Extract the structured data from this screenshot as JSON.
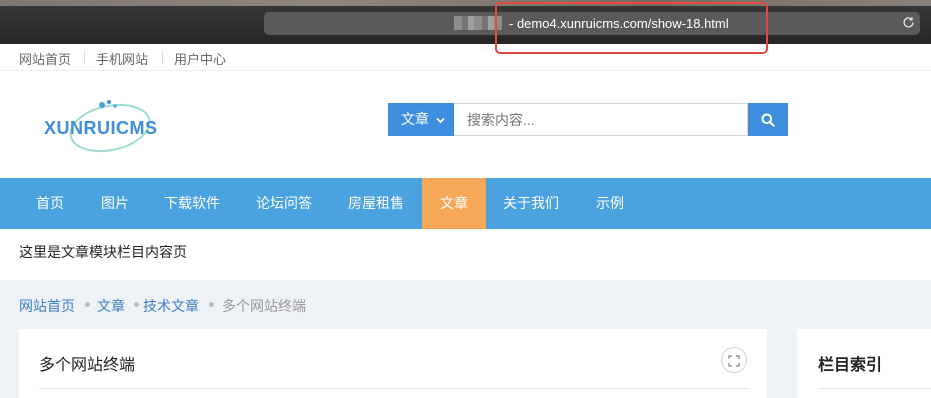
{
  "browser": {
    "url": "- demo4.xunruicms.com/show-18.html",
    "reload_icon": "reload-icon"
  },
  "topbar": {
    "links": [
      "网站首页",
      "手机网站",
      "用户中心"
    ]
  },
  "logo": {
    "text": "XUNRUICMS"
  },
  "search": {
    "category_label": "文章",
    "placeholder": "搜索内容...",
    "icon": "search-icon"
  },
  "nav": {
    "items": [
      "首页",
      "图片",
      "下载软件",
      "论坛问答",
      "房屋租售",
      "文章",
      "关于我们",
      "示例"
    ],
    "active": "文章"
  },
  "intro_text": "这里是文章模块栏目内容页",
  "breadcrumb": [
    "网站首页",
    "文章",
    "技术文章",
    "多个网站终端"
  ],
  "main_panel": {
    "title": "多个网站终端",
    "expand_icon": "expand-icon"
  },
  "side_panel": {
    "title": "栏目索引"
  },
  "colors": {
    "nav_bg": "#4aa3df",
    "nav_active": "#f5a857",
    "search_btn": "#3d8ede",
    "content_bg": "#eef1f6",
    "highlight": "#e04848"
  }
}
